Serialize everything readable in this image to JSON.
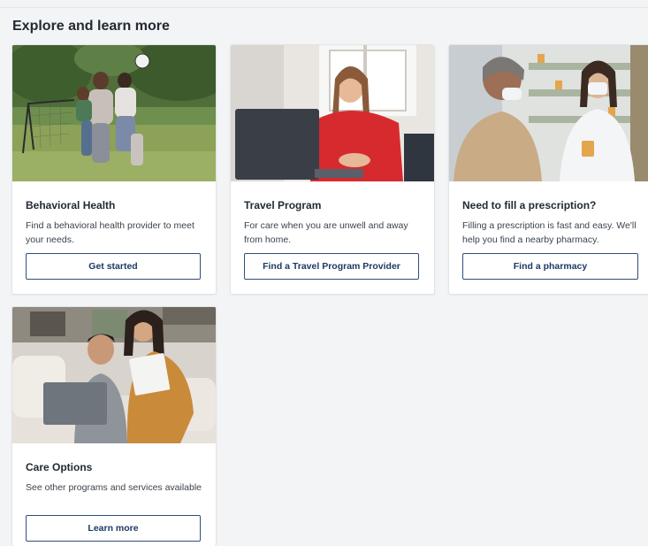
{
  "section": {
    "title": "Explore and learn more"
  },
  "cards": [
    {
      "title": "Behavioral Health",
      "description": "Find a behavioral health provider to meet your needs.",
      "button": "Get started"
    },
    {
      "title": "Travel Program",
      "description": "For care when you are unwell and away from home.",
      "button": "Find a Travel Program Provider"
    },
    {
      "title": "Need to fill a prescription?",
      "description": "Filling a prescription is fast and easy. We'll help you find a nearby pharmacy.",
      "button": "Find a pharmacy"
    },
    {
      "title": "Care Options",
      "description": "See other programs and services available",
      "button": "Learn more"
    }
  ],
  "colors": {
    "accent": "#1d3a63",
    "button_border": "#2d4f7c",
    "background": "#f3f4f5"
  }
}
